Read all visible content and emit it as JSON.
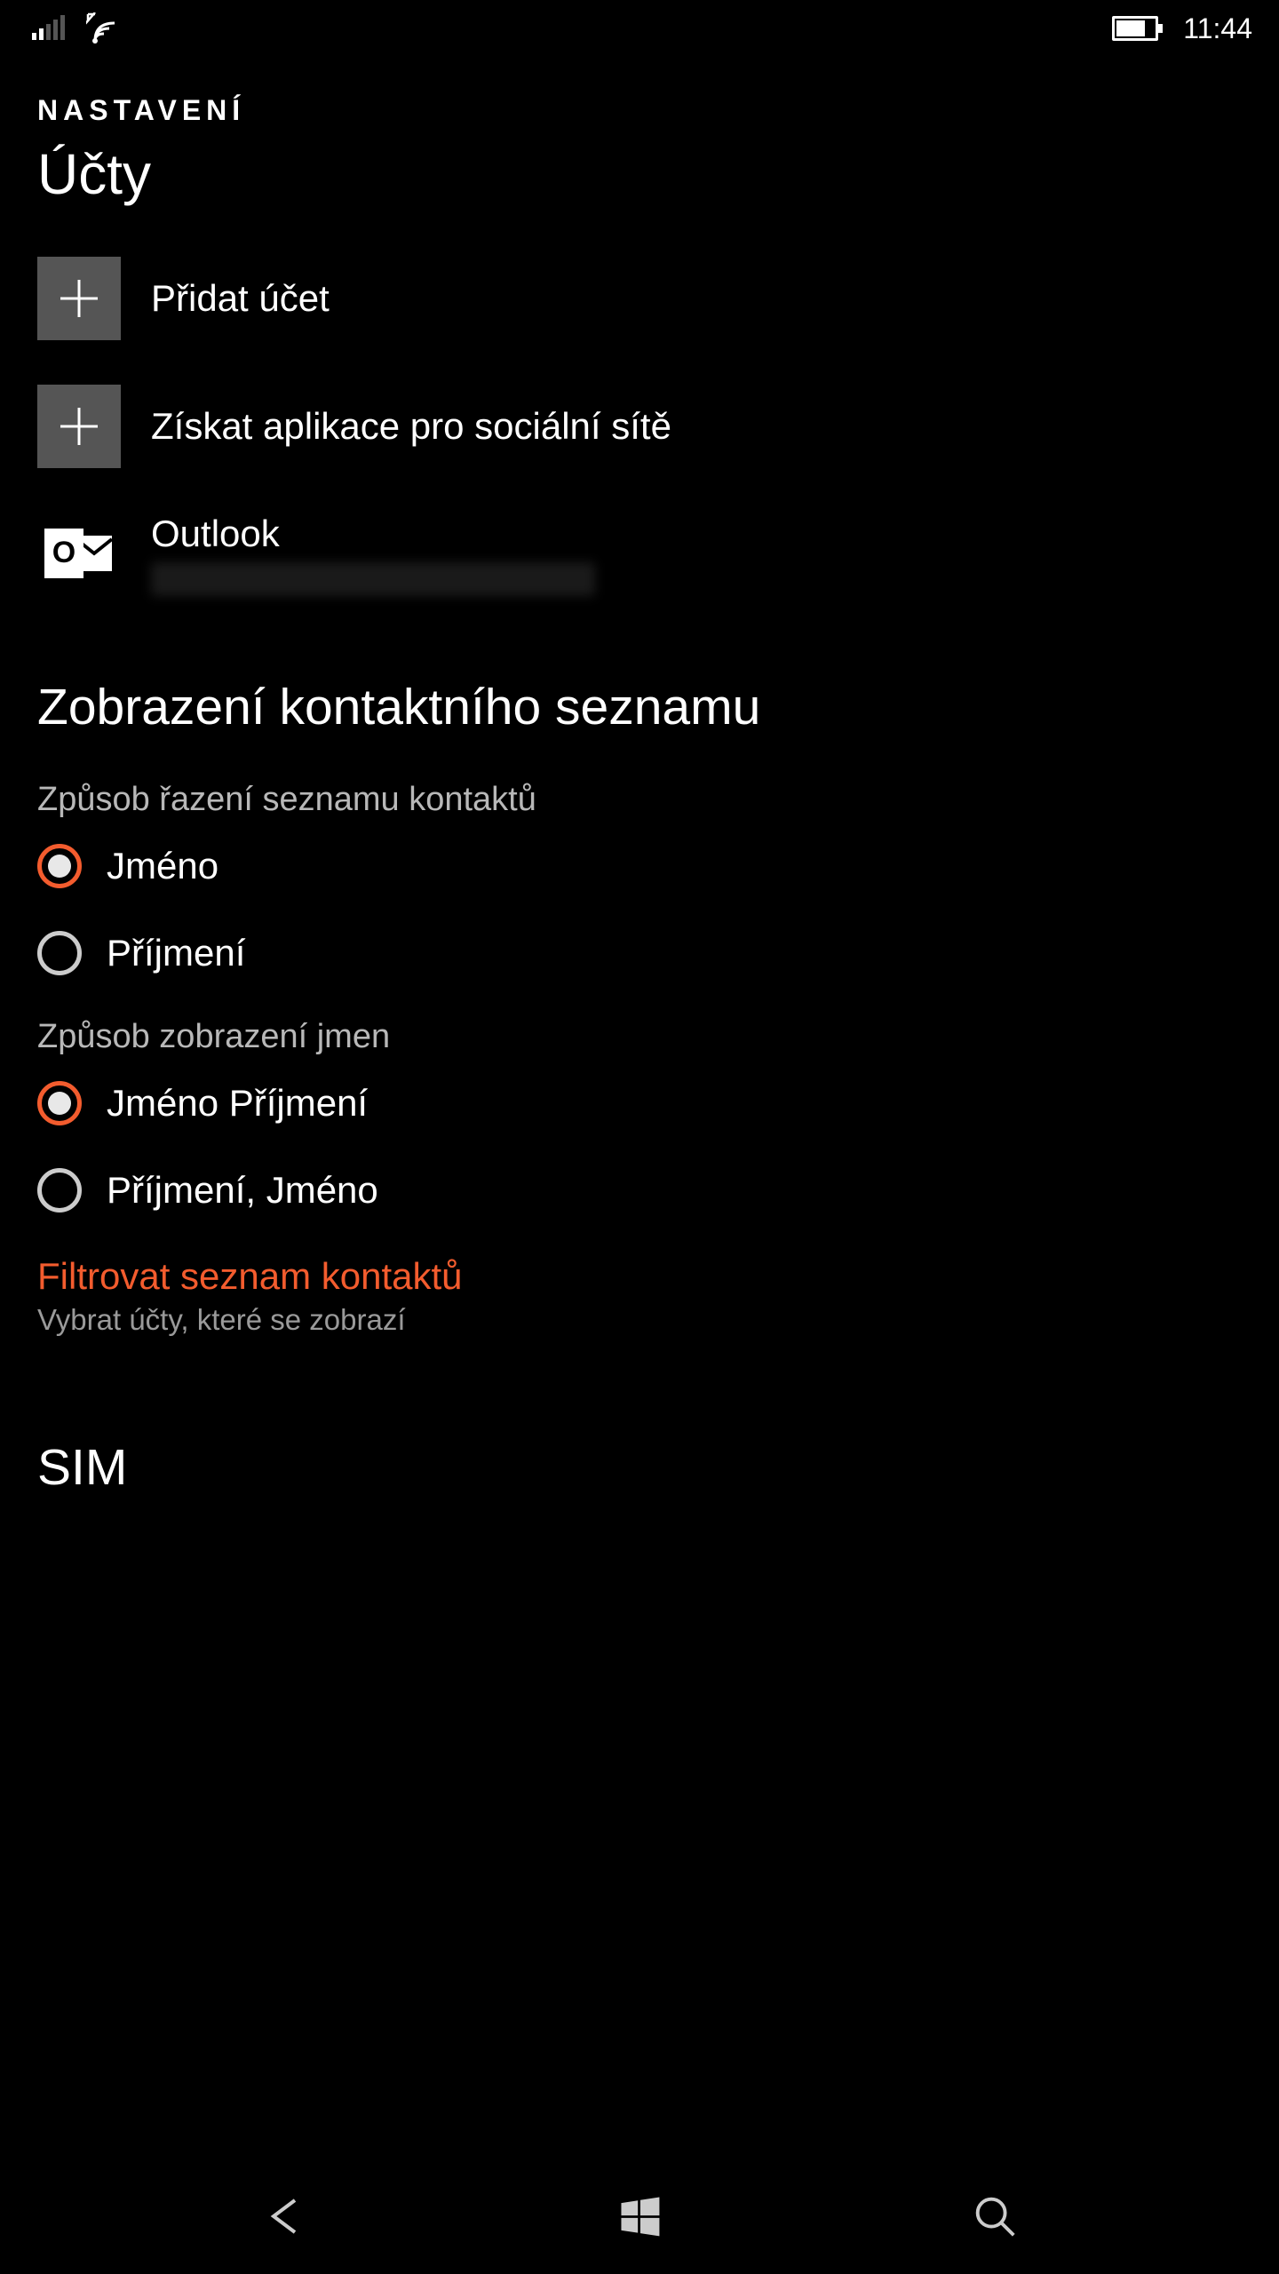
{
  "status": {
    "time": "11:44"
  },
  "header": {
    "app_title": "NASTAVENÍ",
    "section": "Účty"
  },
  "accounts": {
    "add_account": "Přidat účet",
    "get_social": "Získat aplikace pro sociální sítě",
    "outlook": "Outlook"
  },
  "contacts": {
    "section_title": "Zobrazení kontaktního seznamu",
    "sort_label": "Způsob řazení seznamu kontaktů",
    "sort_options": {
      "first": "Jméno",
      "last": "Příjmení"
    },
    "display_label": "Způsob zobrazení jmen",
    "display_options": {
      "first_last": "Jméno Příjmení",
      "last_first": "Příjmení, Jméno"
    },
    "filter_link": "Filtrovat seznam kontaktů",
    "filter_sub": "Vybrat účty, které se zobrazí"
  },
  "sim": {
    "title": "SIM"
  },
  "colors": {
    "accent": "#f35c2e"
  }
}
